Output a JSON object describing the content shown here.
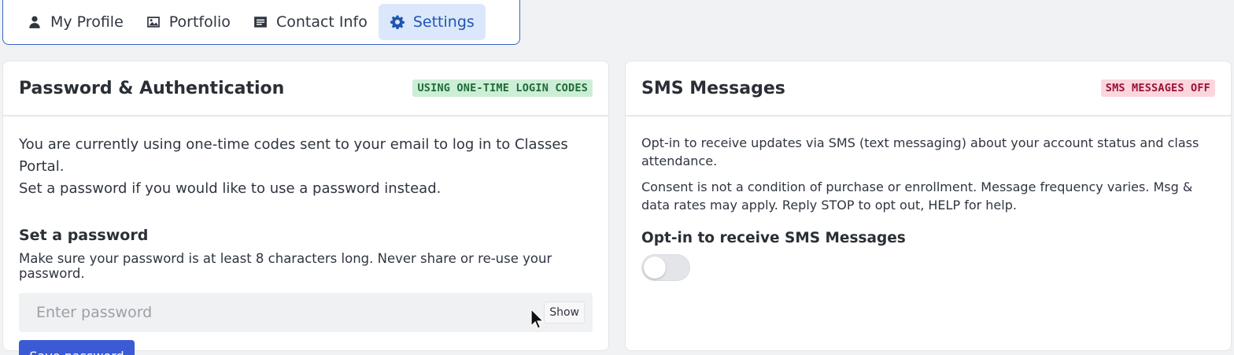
{
  "tabs": [
    {
      "label": "My Profile",
      "icon": "user-icon"
    },
    {
      "label": "Portfolio",
      "icon": "image-icon"
    },
    {
      "label": "Contact Info",
      "icon": "card-icon"
    },
    {
      "label": "Settings",
      "icon": "gear-icon",
      "active": true
    }
  ],
  "password": {
    "title": "Password & Authentication",
    "badge": "USING ONE-TIME LOGIN CODES",
    "intro_line1": "You are currently using one-time codes sent to your email to log in to Classes Portal.",
    "intro_line2": "Set a password if you would like to use a password instead.",
    "set_title": "Set a password",
    "help": "Make sure your password is at least 8 characters long. Never share or re-use your password.",
    "placeholder": "Enter password",
    "show_label": "Show",
    "save_label": "Save password"
  },
  "sms": {
    "title": "SMS Messages",
    "badge": "SMS MESSAGES OFF",
    "p1": "Opt-in to receive updates via SMS (text messaging) about your account status and class attendance.",
    "p2": "Consent is not a condition of purchase or enrollment. Message frequency varies. Msg & data rates may apply. Reply STOP to opt out, HELP for help.",
    "optin_label": "Opt-in to receive SMS Messages",
    "optin_enabled": false
  },
  "colors": {
    "accent": "#3a5bd4",
    "active_tab_bg": "#dbe7fb",
    "badge_green_bg": "#cdeed6",
    "badge_red_bg": "#fbd6dd"
  }
}
